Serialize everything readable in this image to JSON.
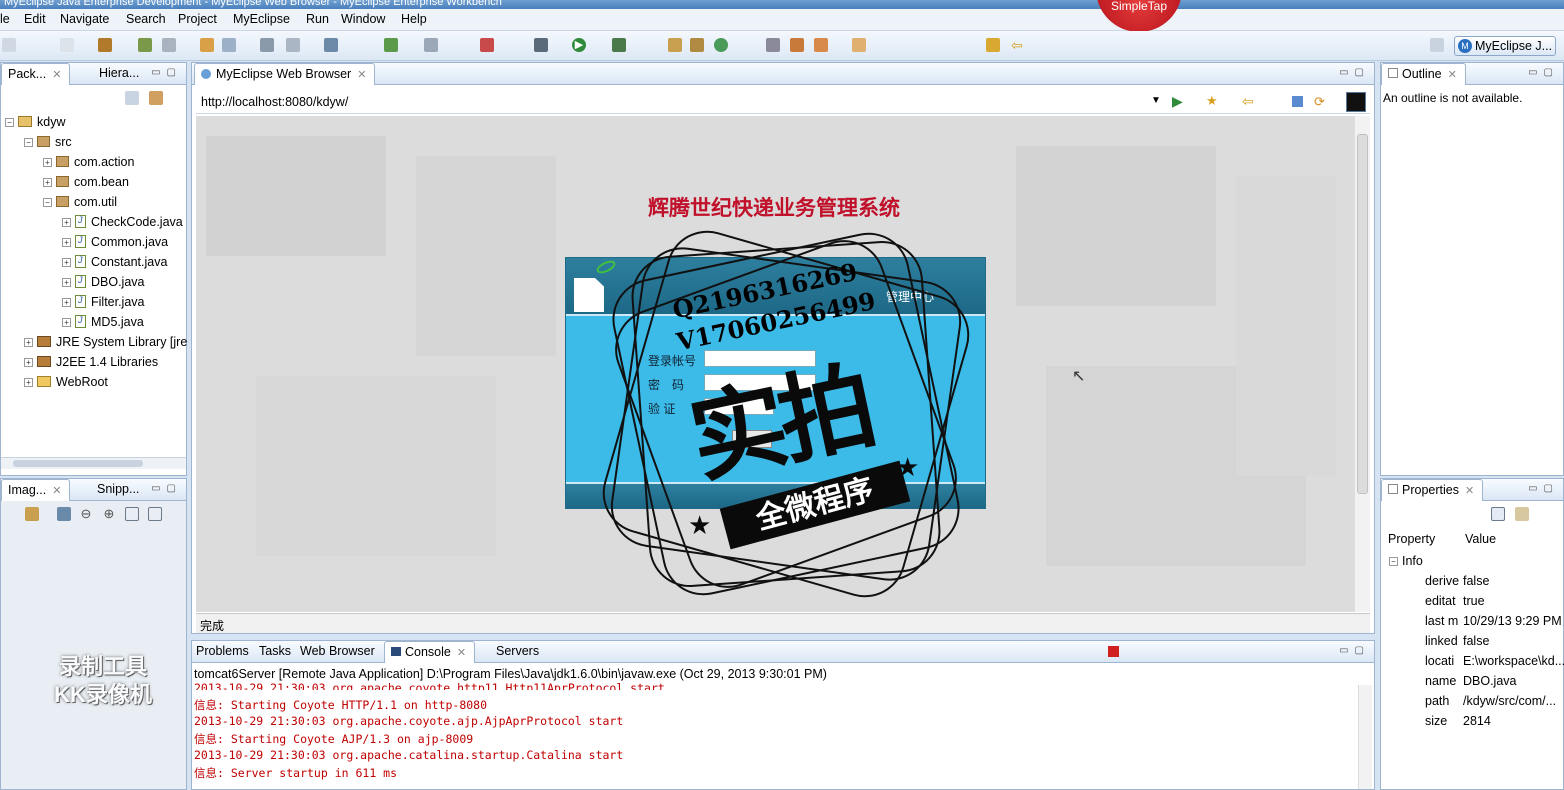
{
  "window": {
    "title": "MyEclipse Java Enterprise Development - MyEclipse Web Browser - MyEclipse Enterprise Workbench"
  },
  "menu": [
    "le",
    "Edit",
    "Navigate",
    "Search",
    "Project",
    "MyEclipse",
    "Run",
    "Window",
    "Help"
  ],
  "simpletap": "SimpleTap",
  "perspective": {
    "label": "MyEclipse J...",
    "badge": "M"
  },
  "left_panel": {
    "tabs": [
      "Pack...",
      "Hiera..."
    ],
    "tree": [
      {
        "label": "kdyw",
        "icon": "project-icon",
        "indent": 0,
        "exp": "−"
      },
      {
        "label": "src",
        "icon": "package-folder-icon",
        "indent": 1,
        "exp": "−"
      },
      {
        "label": "com.action",
        "icon": "package-icon",
        "indent": 2,
        "exp": "+"
      },
      {
        "label": "com.bean",
        "icon": "package-icon",
        "indent": 2,
        "exp": "+"
      },
      {
        "label": "com.util",
        "icon": "package-icon",
        "indent": 2,
        "exp": "−"
      },
      {
        "label": "CheckCode.java",
        "icon": "java-file-icon",
        "indent": 3,
        "exp": "+"
      },
      {
        "label": "Common.java",
        "icon": "java-file-icon",
        "indent": 3,
        "exp": "+"
      },
      {
        "label": "Constant.java",
        "icon": "java-file-icon",
        "indent": 3,
        "exp": "+"
      },
      {
        "label": "DBO.java",
        "icon": "java-file-icon",
        "indent": 3,
        "exp": "+"
      },
      {
        "label": "Filter.java",
        "icon": "java-file-icon",
        "indent": 3,
        "exp": "+"
      },
      {
        "label": "MD5.java",
        "icon": "java-file-icon",
        "indent": 3,
        "exp": "+"
      },
      {
        "label": "JRE System Library [jre",
        "icon": "library-icon",
        "indent": 1,
        "exp": "+"
      },
      {
        "label": "J2EE 1.4 Libraries",
        "icon": "library-icon",
        "indent": 1,
        "exp": "+"
      },
      {
        "label": "WebRoot",
        "icon": "folder-icon",
        "indent": 1,
        "exp": "+"
      }
    ]
  },
  "image_panel": {
    "tabs": [
      "Imag...",
      "Snipp..."
    ]
  },
  "watermark_recorder": {
    "line1": "录制工具",
    "line2": "KK录像机"
  },
  "browser": {
    "tab": "MyEclipse Web Browser",
    "url": "http://localhost:8080/kdyw/",
    "status": "完成",
    "page_title": "辉腾世纪快递业务管理系统",
    "login": {
      "header": "管理中心",
      "username_label": "登录帐号",
      "password_label": "密　码",
      "code_label": "验 证"
    }
  },
  "stamp": {
    "qq": "Q2196316269",
    "wx": "V17060256499",
    "big": "实拍",
    "banner": "全微程序"
  },
  "outline": {
    "tab": "Outline",
    "message": "An outline is not available."
  },
  "properties": {
    "tab": "Properties",
    "col_property": "Property",
    "col_value": "Value",
    "group": "Info",
    "rows": [
      {
        "k": "derive",
        "v": "false"
      },
      {
        "k": "editat",
        "v": "true"
      },
      {
        "k": "last m",
        "v": "10/29/13 9:29 PM"
      },
      {
        "k": "linked",
        "v": "false"
      },
      {
        "k": "locati",
        "v": "E:\\workspace\\kd..."
      },
      {
        "k": "name",
        "v": "DBO.java"
      },
      {
        "k": "path",
        "v": "/kdyw/src/com/..."
      },
      {
        "k": "size",
        "v": "2814"
      }
    ]
  },
  "bottom": {
    "tabs": [
      "Problems",
      "Tasks",
      "Web Browser",
      "Console",
      "Servers"
    ],
    "header": "tomcat6Server [Remote Java Application] D:\\Program Files\\Java\\jdk1.6.0\\bin\\javaw.exe (Oct 29, 2013 9:30:01 PM)",
    "lines": [
      "2013-10-29 21:30:03 org.apache.coyote.http11.Http11AprProtocol start",
      "信息: Starting Coyote HTTP/1.1 on http-8080",
      "2013-10-29 21:30:03 org.apache.coyote.ajp.AjpAprProtocol start",
      "信息: Starting Coyote AJP/1.3 on ajp-8009",
      "2013-10-29 21:30:03 org.apache.catalina.startup.Catalina start",
      "信息: Server startup in 611 ms"
    ]
  },
  "colors": {
    "accent": "#4a7fbd",
    "console_text": "#c00000",
    "title_red": "#c0102a",
    "login_blue": "#3cbbe8"
  }
}
